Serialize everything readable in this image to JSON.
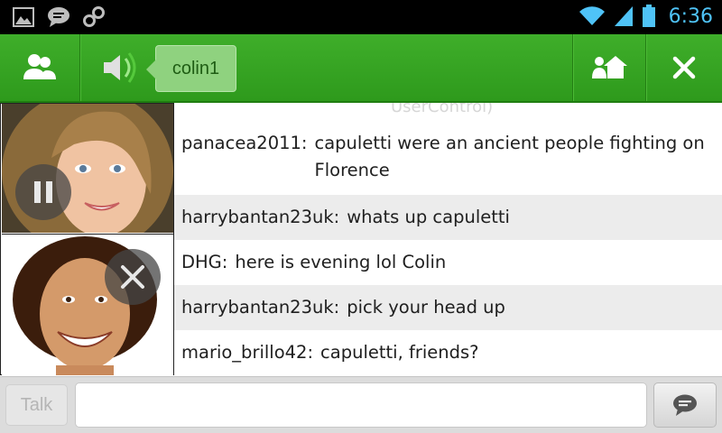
{
  "status_bar": {
    "time": "6:36",
    "icons": [
      "gallery-icon",
      "chat-bubble-icon",
      "share-icon",
      "wifi-icon",
      "signal-icon",
      "battery-icon"
    ]
  },
  "action_bar": {
    "nickname": "colin1",
    "icons": [
      "contacts-icon",
      "speaker-icon",
      "home-users-icon",
      "close-icon"
    ],
    "accent": "#3fae2a"
  },
  "chat": {
    "top_partial": "UserControl)",
    "messages": [
      {
        "user": "panacea2011:",
        "text": "capuletti were an ancient people fighting on Florence"
      },
      {
        "user": "harrybantan23uk:",
        "text": "whats up capuletti"
      },
      {
        "user": "DHG:",
        "text": "here is evening lol Colin"
      },
      {
        "user": "harrybantan23uk:",
        "text": "pick your head up"
      },
      {
        "user": "mario_brillo42:",
        "text": "capuletti, friends?"
      }
    ]
  },
  "video": {
    "icons": [
      "pause-icon",
      "close-icon"
    ]
  },
  "bottom_bar": {
    "talk_label": "Talk",
    "input_placeholder": "",
    "send_icon": "message-send-icon"
  }
}
